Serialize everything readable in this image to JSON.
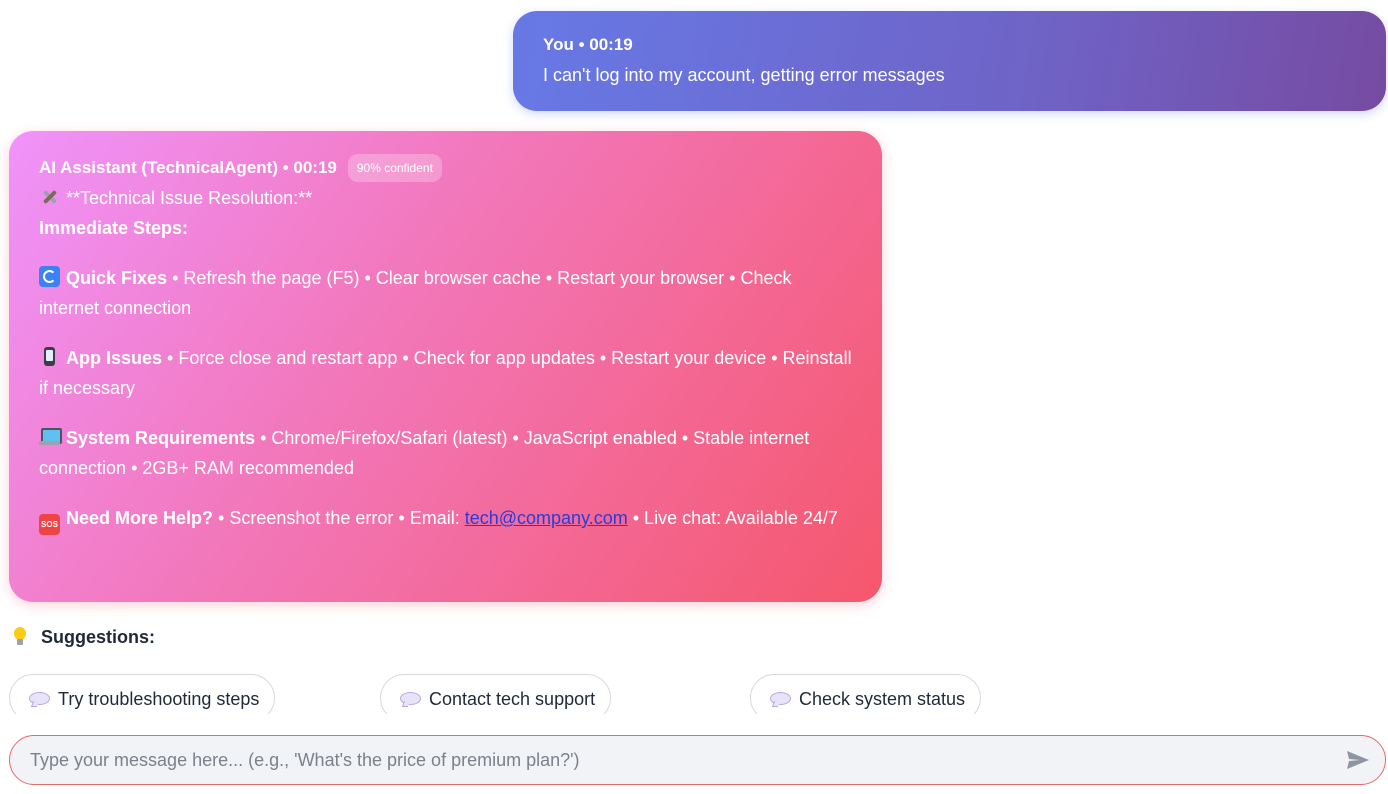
{
  "user_message": {
    "meta": "You • 00:19",
    "text": "I can't log into my account, getting error messages"
  },
  "ai_message": {
    "meta": "AI Assistant (TechnicalAgent) • 00:19",
    "confidence": "90% confident",
    "heading": "**Technical Issue Resolution:**",
    "immediate_steps": "Immediate Steps:",
    "sections": [
      {
        "icon": "refresh-icon",
        "title": "Quick Fixes",
        "text": " • Refresh the page (F5) • Clear browser cache • Restart your browser • Check internet connection"
      },
      {
        "icon": "mobile-phone-icon",
        "title": "App Issues",
        "text": " • Force close and restart app • Check for app updates • Restart your device • Reinstall if necessary"
      },
      {
        "icon": "laptop-icon",
        "title": "System Requirements",
        "text": " • Chrome/Firefox/Safari (latest) • JavaScript enabled • Stable internet connection • 2GB+ RAM recommended"
      },
      {
        "icon": "sos-icon",
        "title": "Need More Help?",
        "text_before": " • Screenshot the error • Email: ",
        "email": "tech@company.com",
        "text_after": " • Live chat: Available 24/7"
      }
    ]
  },
  "suggestions": {
    "title": "Suggestions:",
    "items": [
      "Try troubleshooting steps",
      "Contact tech support",
      "Check system status"
    ]
  },
  "input": {
    "placeholder": "Type your message here... (e.g., 'What's the price of premium plan?')",
    "value": ""
  },
  "colors": {
    "user_gradient": [
      "#667eea",
      "#764ba2"
    ],
    "ai_gradient": [
      "#f093fb",
      "#f5576c"
    ],
    "input_border": "#e46a6a"
  }
}
